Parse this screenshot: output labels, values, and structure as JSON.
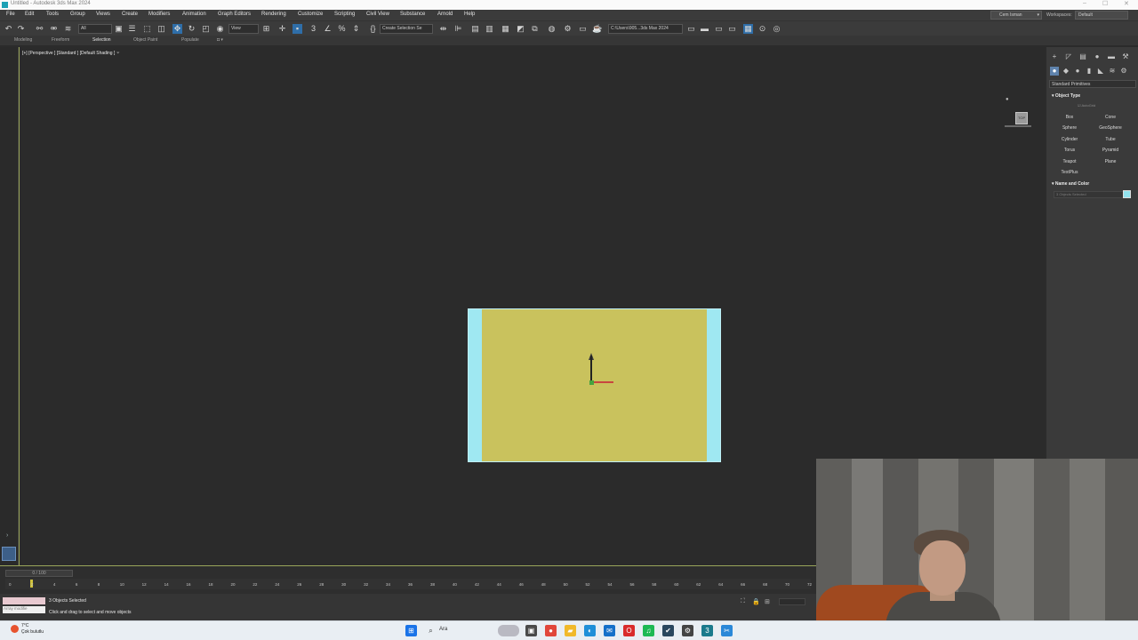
{
  "window": {
    "title": "Untitled - Autodesk 3ds Max 2024",
    "min": "–",
    "max": "☐",
    "close": "✕"
  },
  "menu": {
    "items": [
      "File",
      "Edit",
      "Tools",
      "Group",
      "Views",
      "Create",
      "Modifiers",
      "Animation",
      "Graph Editors",
      "Rendering",
      "Customize",
      "Scripting",
      "Civil View",
      "Substance",
      "Arnold",
      "Help"
    ],
    "user": "Cem Isman",
    "workspaces_label": "Workspaces:",
    "workspace": "Default"
  },
  "toolbar": {
    "filter": "All",
    "view": "View",
    "selection_set": "Create Selection Se",
    "path": "C:\\Users\\905...3ds Max 2024"
  },
  "ribbon": {
    "tabs": [
      "Modeling",
      "Freeform",
      "Selection",
      "Object Paint",
      "Populate"
    ],
    "active": "Selection"
  },
  "viewport": {
    "label": "[+] [Perspective ] [Standard ] [Default Shading ]",
    "filter_icon": "funnel-icon",
    "viewcube_face": "TOP"
  },
  "command_panel": {
    "category": "Standard Primitives",
    "object_type_title": "Object Type",
    "autogrid": "AutoGrid",
    "primitives": [
      "Box",
      "Cone",
      "Sphere",
      "GeoSphere",
      "Cylinder",
      "Tube",
      "Torus",
      "Pyramid",
      "Teapot",
      "Plane",
      "TextPlus"
    ],
    "name_color_title": "Name and Color",
    "name_field": "3 Objects Selected",
    "color": "#93e3ee"
  },
  "timeline": {
    "slider": "0 / 100",
    "ticks": [
      "0",
      "2",
      "4",
      "6",
      "8",
      "10",
      "12",
      "14",
      "16",
      "18",
      "20",
      "22",
      "24",
      "26",
      "28",
      "30",
      "32",
      "34",
      "36",
      "38",
      "40",
      "42",
      "44",
      "46",
      "48",
      "50",
      "52",
      "54",
      "56",
      "58",
      "60",
      "62",
      "64",
      "66",
      "68",
      "70",
      "72"
    ],
    "current_frame": 0
  },
  "status": {
    "maxscript": "Array modifie",
    "selected": "3 Objects Selected",
    "hint": "Click and drag to select and move objects"
  },
  "taskbar": {
    "weather_temp": "7°C",
    "weather_desc": "Çok bulutlu",
    "search": "Ara"
  },
  "colors": {
    "accent": "#5f83ad",
    "plane": "#c9c25d",
    "selection": "#9fe8f2",
    "active_viewport_border": "#9aa55a"
  }
}
